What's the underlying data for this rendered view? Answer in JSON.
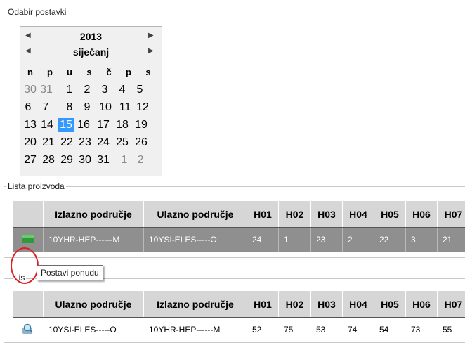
{
  "section1": {
    "legend": "Odabir postavki"
  },
  "calendar": {
    "year": "2013",
    "month": "siječanj",
    "nav_prev": "◀",
    "nav_next": "▶",
    "weekdays": [
      "n",
      "p",
      "u",
      "s",
      "č",
      "p",
      "s"
    ],
    "weeks": [
      [
        "30",
        "31",
        "1",
        "2",
        "3",
        "4",
        "5"
      ],
      [
        "6",
        "7",
        "8",
        "9",
        "10",
        "11",
        "12"
      ],
      [
        "13",
        "14",
        "15",
        "16",
        "17",
        "18",
        "19"
      ],
      [
        "20",
        "21",
        "22",
        "23",
        "24",
        "25",
        "26"
      ],
      [
        "27",
        "28",
        "29",
        "30",
        "31",
        "1",
        "2"
      ]
    ],
    "selected": "15"
  },
  "section2": {
    "legend": "Lista proizvoda"
  },
  "table1": {
    "headers": [
      "Izlazno područje",
      "Ulazno područje",
      "H01",
      "H02",
      "H03",
      "H04",
      "H05",
      "H06",
      "H07"
    ],
    "row": {
      "icon": "green-box-icon",
      "cells": [
        "10YHR-HEP------M",
        "10YSI-ELES-----O",
        "24",
        "1",
        "23",
        "2",
        "22",
        "3",
        "21"
      ]
    }
  },
  "section3": {
    "legend": "Lis"
  },
  "tooltip": {
    "text": "Postavi ponudu"
  },
  "table2": {
    "headers": [
      "Ulazno područje",
      "Izlazno područje",
      "H01",
      "H02",
      "H03",
      "H04",
      "H05",
      "H06",
      "H07"
    ],
    "row": {
      "icon": "magnifier-icon",
      "cells": [
        "10YSI-ELES-----O",
        "10YHR-HEP------M",
        "52",
        "75",
        "53",
        "74",
        "54",
        "73",
        "55"
      ]
    }
  },
  "colors": {
    "selected_day": "#3399ff",
    "highlight_circle": "#e02020",
    "row_bg": "#8f8f8f",
    "header_bg": "#d6d6d6"
  }
}
